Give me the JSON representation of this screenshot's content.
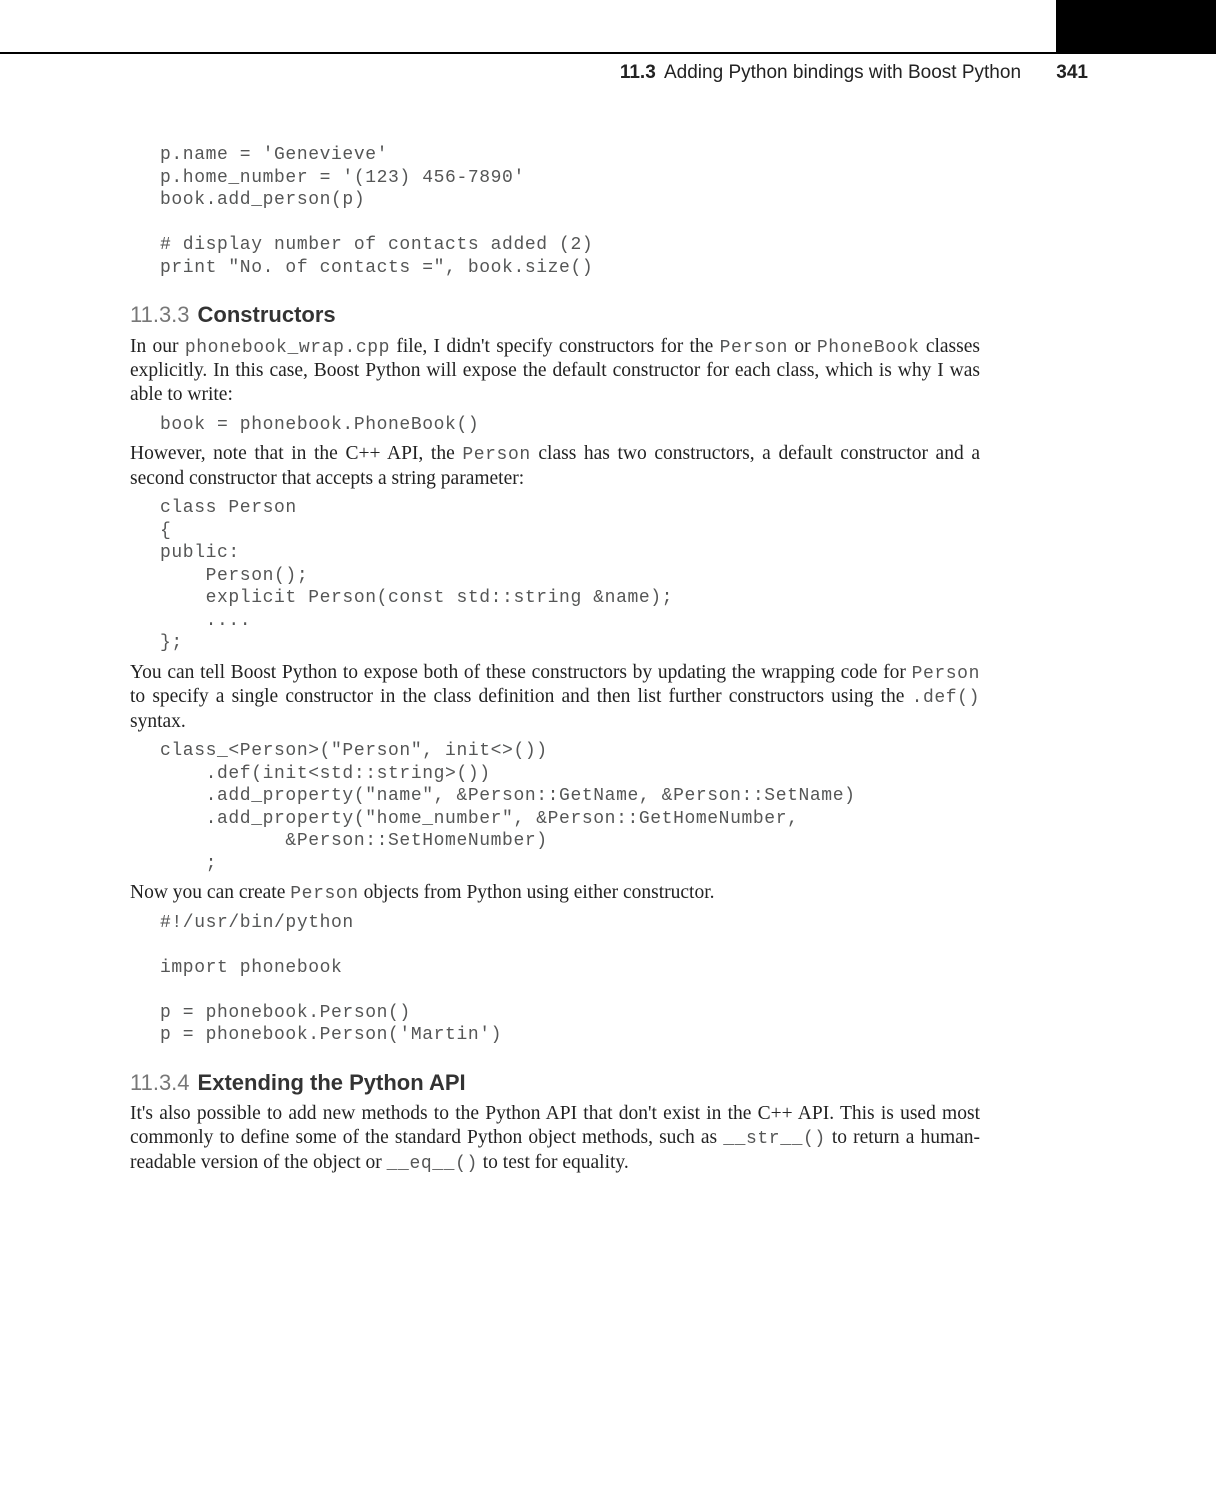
{
  "header": {
    "section_number": "11.3",
    "section_title": "Adding Python bindings with Boost Python",
    "page_number": "341"
  },
  "code_intro": "p.name = 'Genevieve'\np.home_number = '(123) 456-7890'\nbook.add_person(p)\n\n# display number of contacts added (2)\nprint \"No. of contacts =\", book.size()",
  "s1133": {
    "number": "11.3.3",
    "title": "Constructors",
    "p1_a": "In our ",
    "p1_code1": "phonebook_wrap.cpp",
    "p1_b": " file, I didn't specify constructors for the ",
    "p1_code2": "Person",
    "p1_c": " or ",
    "p1_code3": "PhoneBook",
    "p1_d": " classes explicitly. In this case, Boost Python will expose the default constructor for each class, which is why I was able to write:",
    "code1": "book = phonebook.PhoneBook()",
    "p2_a": "However, note that in the C++ API, the ",
    "p2_code1": "Person",
    "p2_b": " class has two constructors, a default constructor and a second constructor that accepts a string parameter:",
    "code2": "class Person\n{\npublic:\n    Person();\n    explicit Person(const std::string &name);\n    ....\n};",
    "p3_a": "You can tell Boost Python to expose both of these constructors by updating the wrapping code for ",
    "p3_code1": "Person",
    "p3_b": " to specify a single constructor in the class definition and then list further constructors using the ",
    "p3_code2": ".def()",
    "p3_c": " syntax.",
    "code3": "class_<Person>(\"Person\", init<>())\n    .def(init<std::string>())\n    .add_property(\"name\", &Person::GetName, &Person::SetName)\n    .add_property(\"home_number\", &Person::GetHomeNumber,\n           &Person::SetHomeNumber)\n    ;",
    "p4_a": "Now you can create ",
    "p4_code1": "Person",
    "p4_b": " objects from Python using either constructor.",
    "code4": "#!/usr/bin/python\n\nimport phonebook\n\np = phonebook.Person()\np = phonebook.Person('Martin')"
  },
  "s1134": {
    "number": "11.3.4",
    "title": "Extending the Python API",
    "p1_a": "It's also possible to add new methods to the Python API that don't exist in the C++ API. This is used most commonly to define some of the standard Python object methods, such as ",
    "p1_code1": "__str__()",
    "p1_b": " to return a human-readable version of the object or ",
    "p1_code2": "__eq__()",
    "p1_c": " to test for equality."
  }
}
